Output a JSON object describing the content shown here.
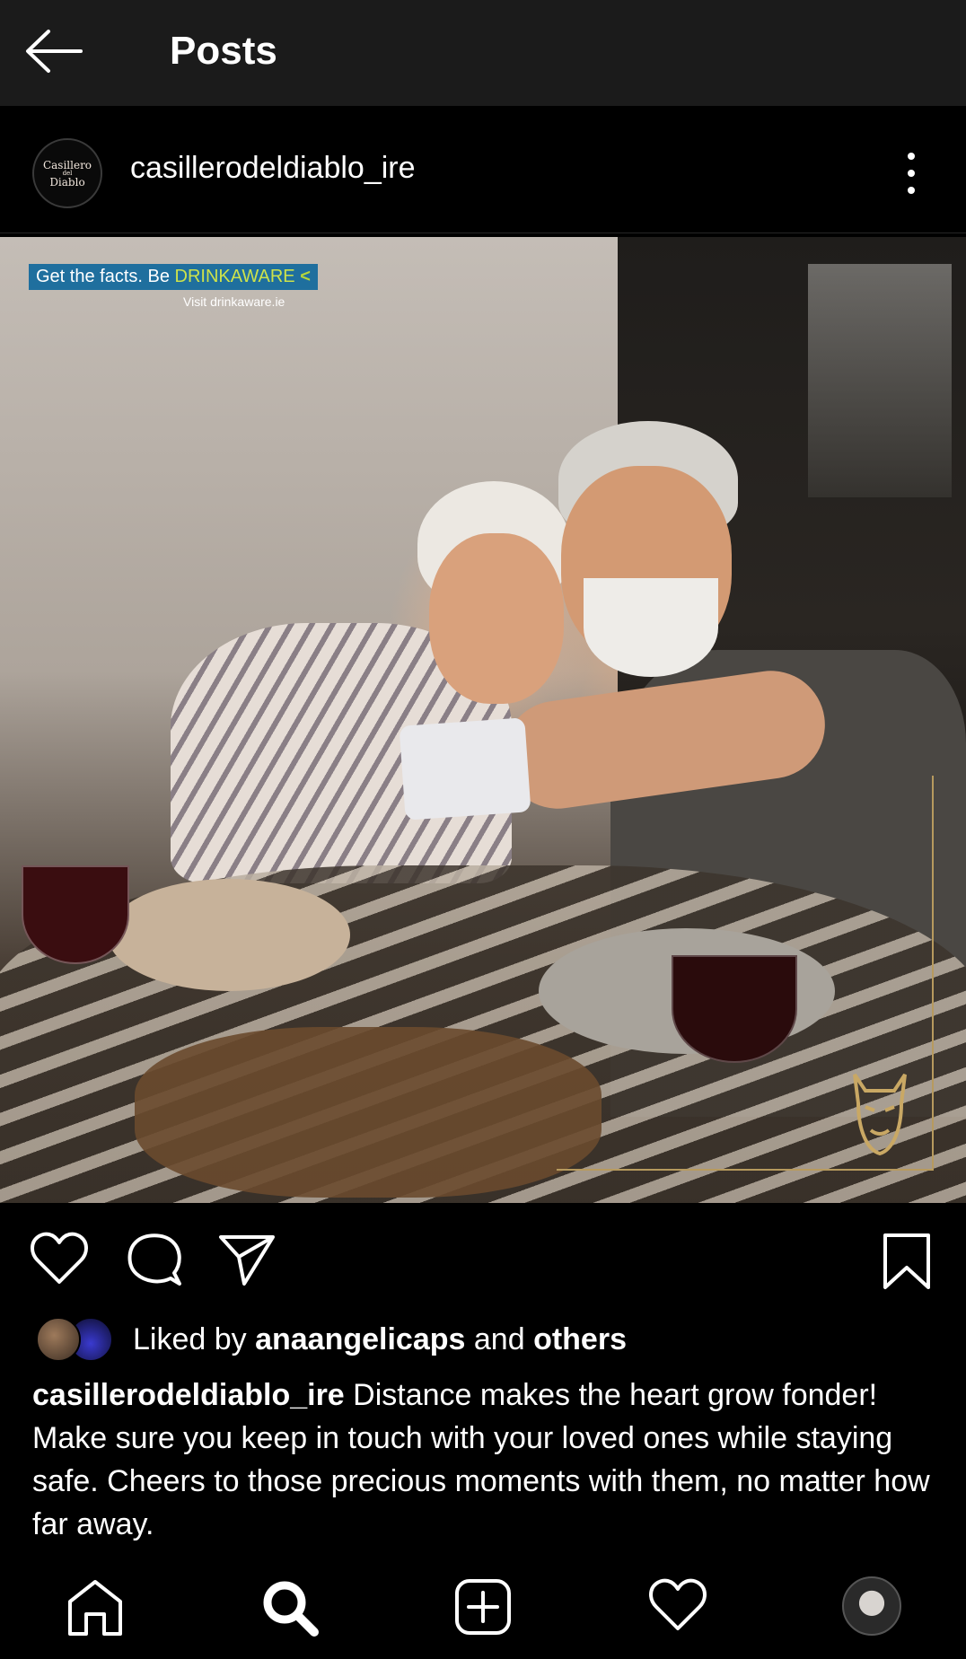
{
  "topbar": {
    "back_icon": "arrow-left-icon",
    "title": "Posts"
  },
  "post": {
    "username": "casillerodeldiablo_ire",
    "avatar_logo": {
      "line1": "Casillero",
      "line2": "del",
      "line3": "Diablo"
    },
    "more_icon": "more-vertical-icon",
    "image": {
      "overlay_brand_prefix": "Get the facts. Be ",
      "overlay_brand": "DRINKAWARE",
      "overlay_chevron": "<",
      "overlay_visit": "Visit drinkaware.ie"
    },
    "actions": {
      "like_icon": "heart-icon",
      "comment_icon": "comment-icon",
      "share_icon": "send-icon",
      "save_icon": "bookmark-icon"
    },
    "likes": {
      "prefix": "Liked by ",
      "user": "anaangelicaps",
      "middle": " and ",
      "others": "others"
    },
    "caption": {
      "username": "casillerodeldiablo_ire",
      "text": " Distance makes the heart grow fonder! Make sure you keep in touch with your loved ones while staying safe. Cheers to those precious moments with them, no matter how far away."
    }
  },
  "bottom_nav": {
    "items": [
      "home-icon",
      "search-icon",
      "new-post-icon",
      "activity-heart-icon",
      "profile-avatar"
    ]
  },
  "colors": {
    "topbar_bg": "#1b1b1b",
    "background": "#000000",
    "text": "#ffffff",
    "drinkaware_blue": "#1f6f9e",
    "drinkaware_green": "#cde24b",
    "frame_gold": "#b79a5e"
  }
}
